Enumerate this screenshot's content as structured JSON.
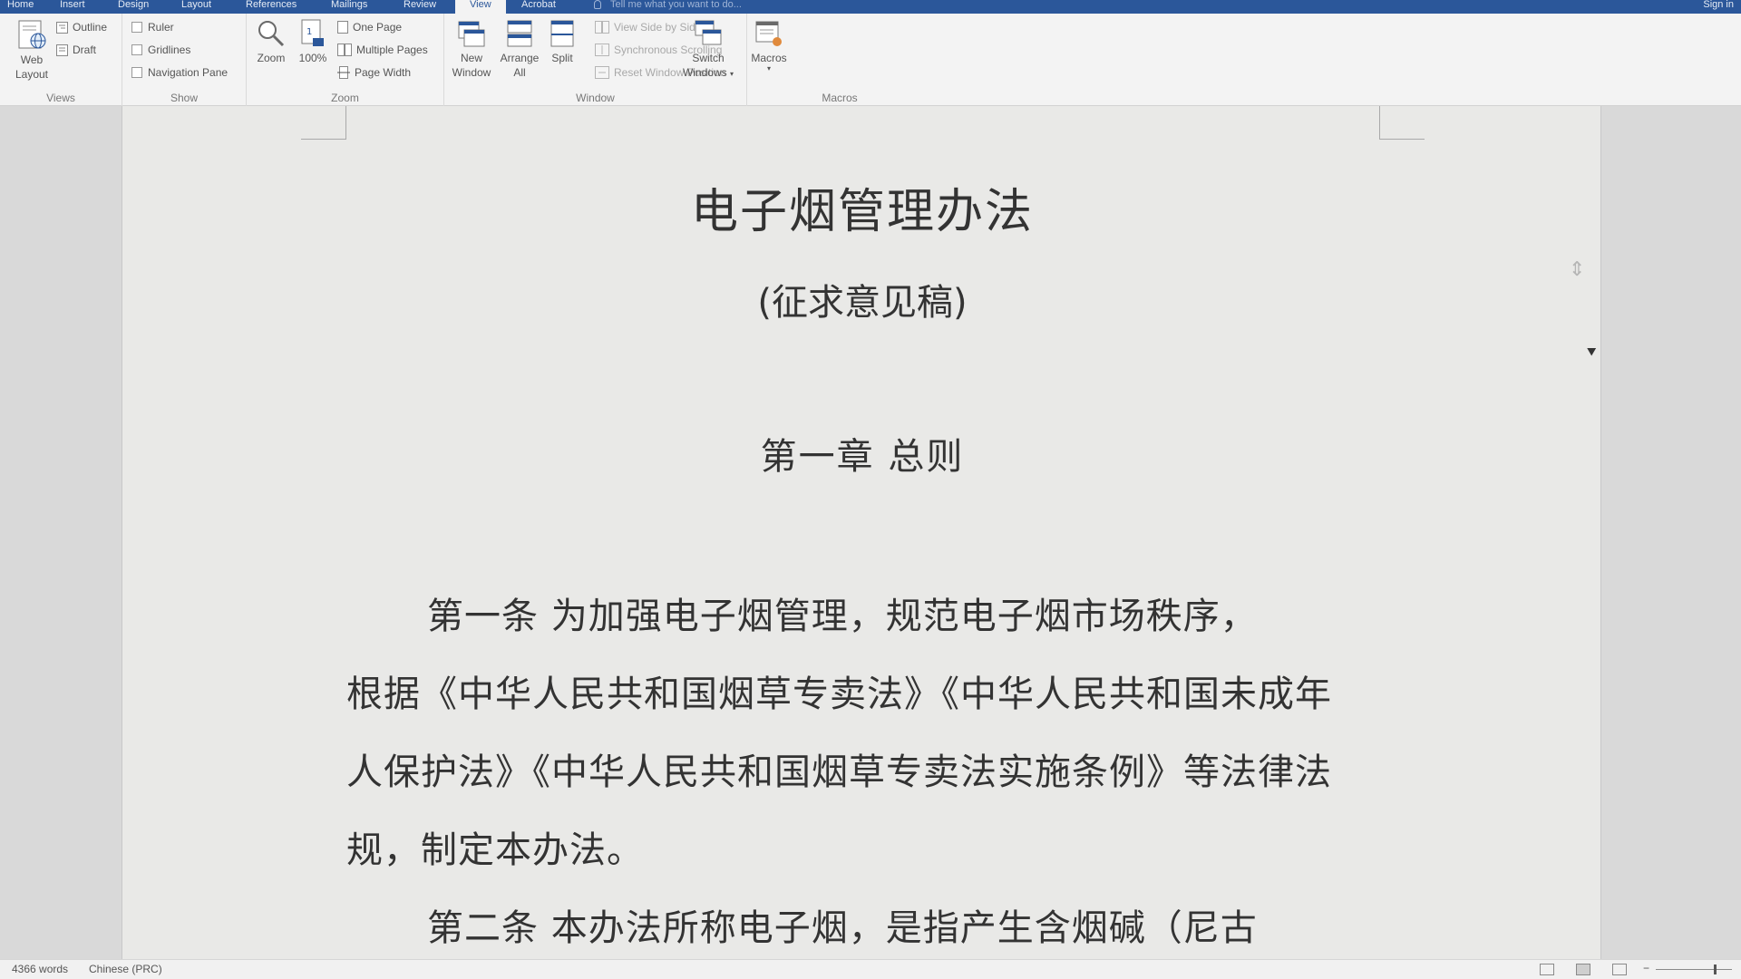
{
  "tabs": [
    {
      "label": "Home",
      "active": false
    },
    {
      "label": "Insert",
      "active": false
    },
    {
      "label": "Design",
      "active": false
    },
    {
      "label": "Layout",
      "active": false
    },
    {
      "label": "References",
      "active": false
    },
    {
      "label": "Mailings",
      "active": false
    },
    {
      "label": "Review",
      "active": false
    },
    {
      "label": "View",
      "active": true
    },
    {
      "label": "Acrobat",
      "active": false
    }
  ],
  "tell_me": "Tell me what you want to do...",
  "sign_in": "Sign in",
  "ribbon": {
    "views": {
      "label": "Views",
      "web_layout_1": "Web",
      "web_layout_2": "Layout",
      "outline": "Outline",
      "draft": "Draft"
    },
    "show": {
      "label": "Show",
      "ruler": "Ruler",
      "gridlines": "Gridlines",
      "navigation_pane": "Navigation Pane"
    },
    "zoom": {
      "label": "Zoom",
      "zoom": "Zoom",
      "hundred": "100%",
      "one_page": "One Page",
      "multiple_pages": "Multiple Pages",
      "page_width": "Page Width"
    },
    "window": {
      "label": "Window",
      "new_window_1": "New",
      "new_window_2": "Window",
      "arrange_all_1": "Arrange",
      "arrange_all_2": "All",
      "split": "Split",
      "view_side_by_side": "View Side by Side",
      "synchronous_scrolling": "Synchronous Scrolling",
      "reset_window_position": "Reset Window Position",
      "switch_windows_1": "Switch",
      "switch_windows_2": "Windows"
    },
    "macros": {
      "label": "Macros",
      "macros": "Macros"
    }
  },
  "document": {
    "title": "电子烟管理办法",
    "subtitle": "(征求意见稿)",
    "chapter": "第一章  总则",
    "lines": [
      "第一条    为加强电子烟管理，规范电子烟市场秩序，",
      "根据《中华人民共和国烟草专卖法》《中华人民共和国未成年",
      "人保护法》《中华人民共和国烟草专卖法实施条例》等法律法",
      "规，制定本办法。",
      "第二条    本办法所称电子烟，是指产生含烟碱（尼古"
    ]
  },
  "status": {
    "words": "4366 words",
    "language": "Chinese (PRC)"
  },
  "colors": {
    "tabbar": "#2b579a",
    "ribbon": "#f3f3f3",
    "page": "#e9e9e7"
  }
}
